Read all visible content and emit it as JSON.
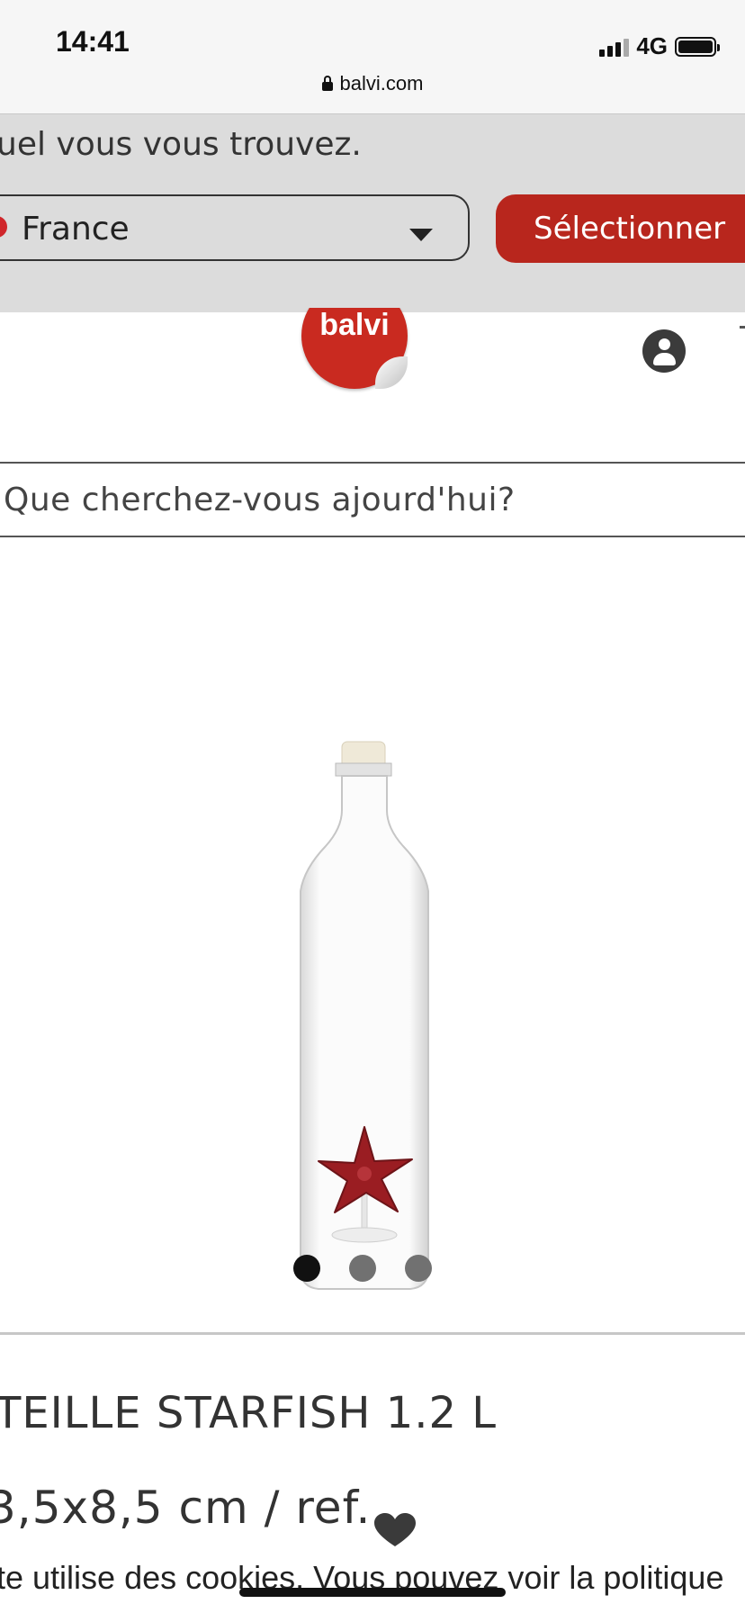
{
  "status_bar": {
    "time": "14:41",
    "network": "4G"
  },
  "browser": {
    "url": "balvi.com"
  },
  "country_banner": {
    "text": "uel vous vous trouvez.",
    "selected_country": "France",
    "select_button": "Sélectionner"
  },
  "header": {
    "logo_text": "balvi"
  },
  "search": {
    "placeholder": "Que cherchez-vous ajourd'hui?"
  },
  "gallery": {
    "total_images": 3,
    "active_index": 0
  },
  "product": {
    "title": "TEILLE STARFISH 1.2 L",
    "dimensions": "3,5x8,5 cm / ref."
  },
  "cookie_notice": {
    "text": "te utilise des cookies. Vous pouvez voir la politique"
  },
  "colors": {
    "accent": "#b8261d",
    "logo_red": "#c92a20",
    "banner_bg": "#dcdcdc"
  },
  "icons": [
    "lock-icon",
    "caret-down-icon",
    "user-icon",
    "heart-icon",
    "starfish-icon"
  ]
}
